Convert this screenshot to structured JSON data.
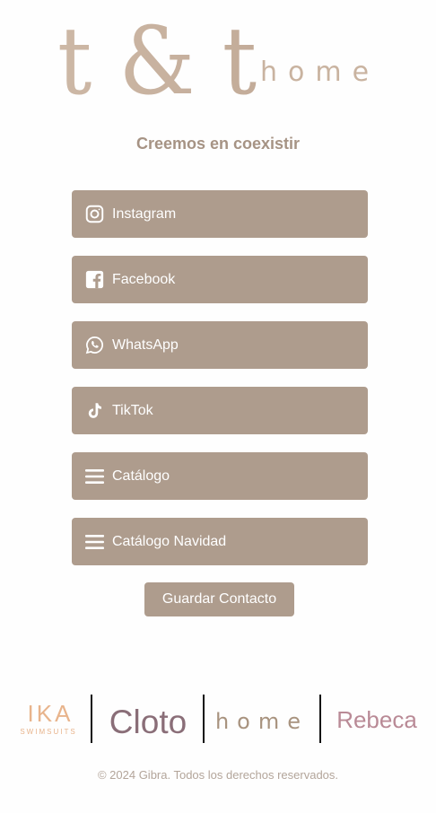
{
  "logo": {
    "mark": "t & t",
    "word": "home"
  },
  "tagline": "Creemos en coexistir",
  "links": [
    {
      "label": "Instagram",
      "icon": "instagram-icon"
    },
    {
      "label": "Facebook",
      "icon": "facebook-icon"
    },
    {
      "label": "WhatsApp",
      "icon": "whatsapp-icon"
    },
    {
      "label": "TikTok",
      "icon": "tiktok-icon"
    },
    {
      "label": "Catálogo",
      "icon": "menu-icon"
    },
    {
      "label": "Catálogo Navidad",
      "icon": "menu-icon"
    }
  ],
  "save_contact": "Guardar Contacto",
  "brands": {
    "ika": "IKA",
    "ika_sub": "SWIMSUITS",
    "cloto": "Cloto",
    "home": "home",
    "rebeca": "Rebeca"
  },
  "footer": "© 2024 Gibra. Todos los derechos reservados.",
  "colors": {
    "button": "#ae9c8d",
    "logo": "#c9b3a0",
    "tagline": "#a69384",
    "footer": "#b3a59a",
    "ika": "#e8b48c",
    "rebeca": "#b98a96",
    "cloto": "#8a6e78"
  }
}
